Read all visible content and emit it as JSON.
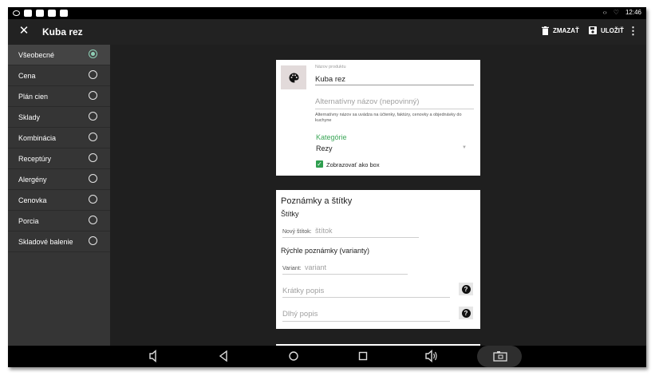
{
  "app": {
    "title": "Kuba rez",
    "delete_label": "ZMAZAŤ",
    "save_label": "ULOŽIŤ",
    "time": "12:46"
  },
  "sidebar": {
    "items": [
      {
        "label": "Všeobecné",
        "selected": true
      },
      {
        "label": "Cena",
        "selected": false
      },
      {
        "label": "Plán cien",
        "selected": false
      },
      {
        "label": "Sklady",
        "selected": false
      },
      {
        "label": "Kombinácia",
        "selected": false
      },
      {
        "label": "Receptúry",
        "selected": false
      },
      {
        "label": "Alergény",
        "selected": false
      },
      {
        "label": "Cenovka",
        "selected": false
      },
      {
        "label": "Porcia",
        "selected": false
      },
      {
        "label": "Skladové balenie",
        "selected": false
      }
    ]
  },
  "product": {
    "name_label": "Názov produktu",
    "name_value": "Kuba rez",
    "alt_name_placeholder": "Alternatívny názov (nepovinný)",
    "alt_name_helper": "Alternatívny názov sa uvádza na účtenky, faktúry, cenovky a objednávky do kuchyne",
    "category_label": "Kategórie",
    "category_value": "Rezy",
    "show_as_box_label": "Zobrazovať ako box",
    "show_as_box_checked": true
  },
  "notes": {
    "title": "Poznámky a štítky",
    "tags_title": "Štítky",
    "new_tag_label": "Nový štítok:",
    "new_tag_placeholder": "štítok",
    "quick_notes_title": "Rýchle poznámky (varianty)",
    "variant_label": "Variant:",
    "variant_placeholder": "variant",
    "short_desc_placeholder": "Krátky popis",
    "long_desc_placeholder": "Dlhý popis",
    "help_symbol": "?"
  },
  "colors": {
    "accent": "#2f9e4f",
    "radio_selected": "#8fd0b6",
    "sidebar_bg": "#353535",
    "content_bg": "#1f1f1f"
  }
}
